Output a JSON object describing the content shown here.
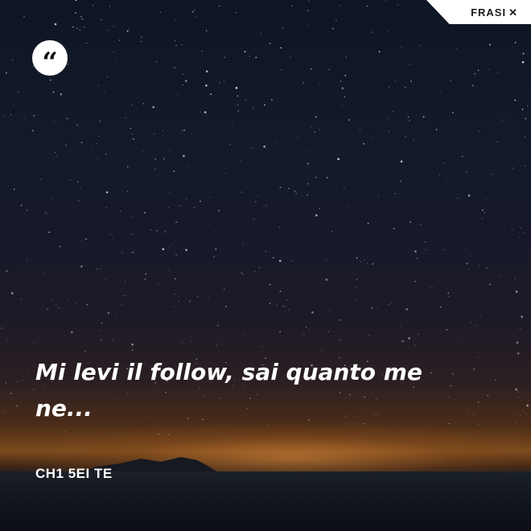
{
  "brand": {
    "name": "FRASI",
    "mark": "✕",
    "icon": "frasi-logo-icon"
  },
  "quote_badge": {
    "glyph": "“",
    "icon": "quote-icon"
  },
  "quote": {
    "text": "Mi levi il follow, sai quanto me ne..."
  },
  "author": {
    "name": "CH1 5EI TE"
  },
  "colors": {
    "text": "#ffffff",
    "badge": "#ffffff",
    "brand_text": "#1b1b1b"
  }
}
